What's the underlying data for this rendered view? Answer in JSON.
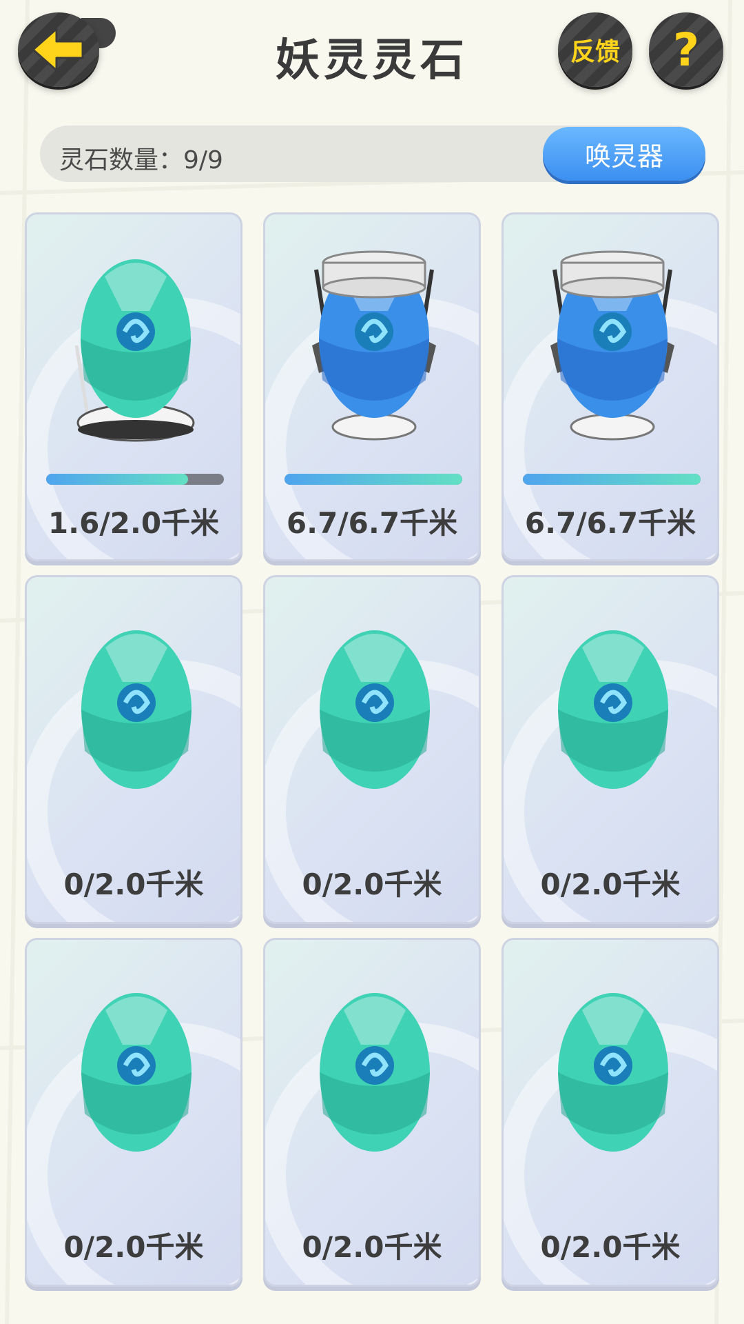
{
  "header": {
    "title": "妖灵灵石",
    "feedback_label": "反馈",
    "help_label": "?"
  },
  "stone_count": {
    "label": "灵石数量：9/9",
    "summon_button": "唤灵器"
  },
  "colors": {
    "accent_yellow": "#ffd41a",
    "summon_blue": "#3b8ff0",
    "progress_start": "#4fa4ee",
    "progress_end": "#63e0c4",
    "egg_teal": "#3fd2b4"
  },
  "stones": [
    {
      "distance": "1.6/2.0千米",
      "progress": 0.8,
      "incubator": "basic",
      "show_progress": true
    },
    {
      "distance": "6.7/6.7千米",
      "progress": 1.0,
      "incubator": "advanced",
      "show_progress": true
    },
    {
      "distance": "6.7/6.7千米",
      "progress": 1.0,
      "incubator": "advanced",
      "show_progress": true
    },
    {
      "distance": "0/2.0千米",
      "progress": 0,
      "incubator": "none",
      "show_progress": false
    },
    {
      "distance": "0/2.0千米",
      "progress": 0,
      "incubator": "none",
      "show_progress": false
    },
    {
      "distance": "0/2.0千米",
      "progress": 0,
      "incubator": "none",
      "show_progress": false
    },
    {
      "distance": "0/2.0千米",
      "progress": 0,
      "incubator": "none",
      "show_progress": false
    },
    {
      "distance": "0/2.0千米",
      "progress": 0,
      "incubator": "none",
      "show_progress": false
    },
    {
      "distance": "0/2.0千米",
      "progress": 0,
      "incubator": "none",
      "show_progress": false
    }
  ]
}
